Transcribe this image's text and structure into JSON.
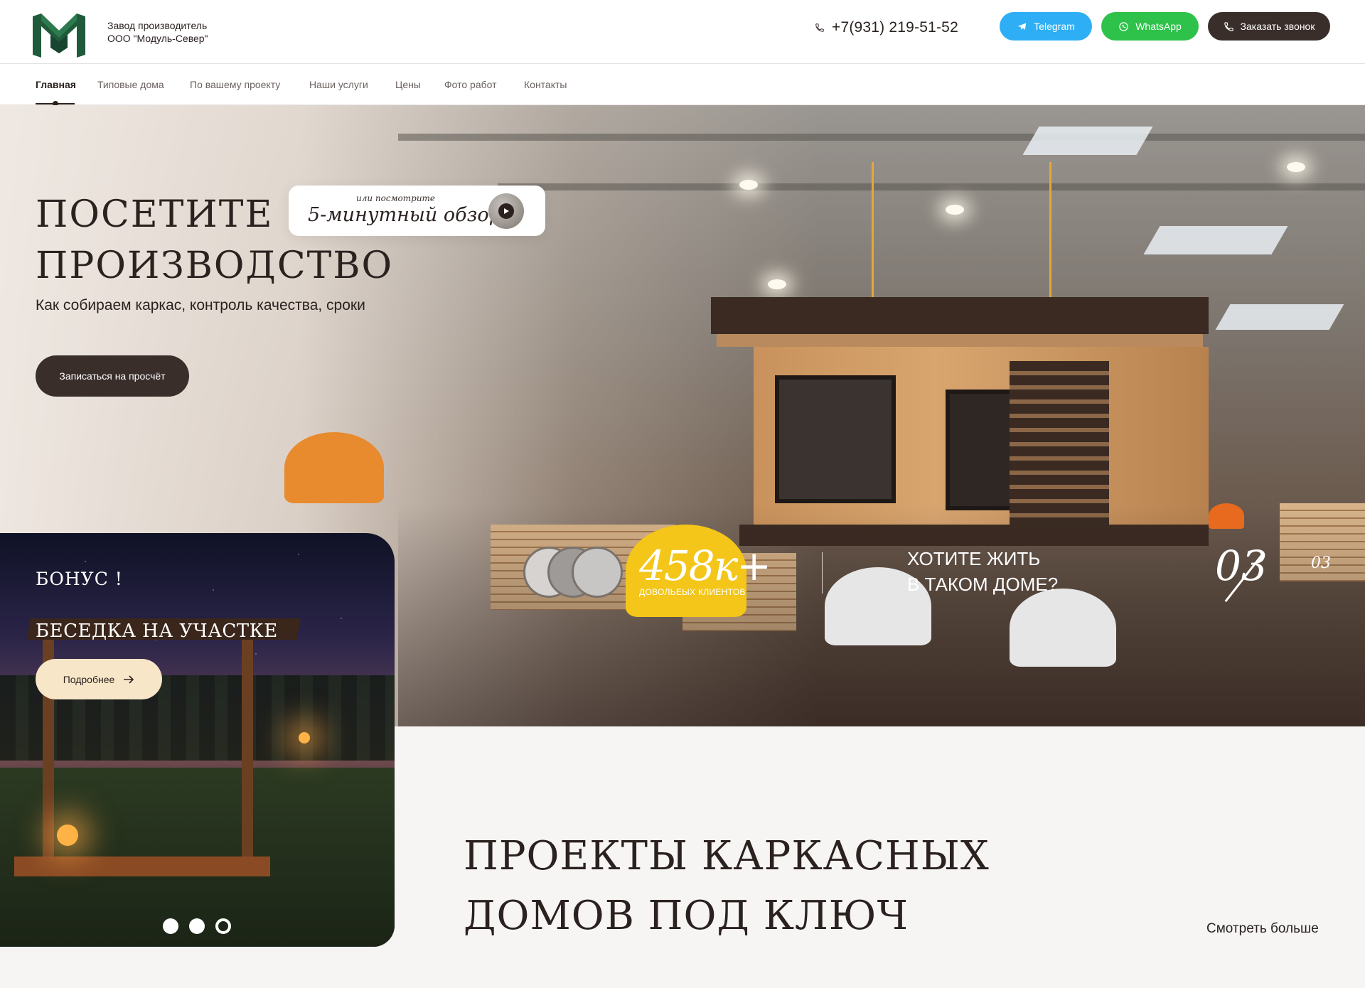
{
  "header": {
    "company_line1": "Завод производитель",
    "company_line2": "ООО \"Модуль-Север\"",
    "phone": "+7(931) 219-51-52",
    "telegram_label": "Telegram",
    "whatsapp_label": "WhatsApp",
    "callback_label": "Заказать звонок",
    "colors": {
      "telegram": "#2eaff5",
      "whatsapp": "#2ec24a",
      "dark": "#3a2e2b",
      "logo_green": "#1f5a3a"
    }
  },
  "nav": {
    "items": [
      {
        "label": "Главная",
        "active": true
      },
      {
        "label": "Типовые дома"
      },
      {
        "label": "По вашему проекту"
      },
      {
        "label": "Наши услуги"
      },
      {
        "label": "Цены"
      },
      {
        "label": "Фото работ"
      },
      {
        "label": "Контакты"
      }
    ]
  },
  "hero": {
    "title_line1": "ПОСЕТИТЕ",
    "title_line2": "ПРОИЗВОДСТВО",
    "subtitle": "Как собираем каркас, контроль качества, сроки",
    "cta_label": "Записаться на просчёт",
    "video_small": "или посмотрите",
    "video_big": "5-минутный обзор"
  },
  "bonus": {
    "title": "БОНУС !",
    "subtitle": "БЕСЕДКА НА УЧАСТКЕ",
    "button_label": "Подробнее",
    "slides_total": 3,
    "active_slide": 3
  },
  "stats": {
    "clients_number": "458к+",
    "clients_label": "ДОВОЛЬЕЫХ КЛИЕНТОВ",
    "question_line1": "ХОТИТЕ ЖИТЬ",
    "question_line2": "В ТАКОМ ДОМЕ?",
    "counter_current": "03",
    "counter_total": "03"
  },
  "projects": {
    "title_line1": "ПРОЕКТЫ КАРКАСНЫХ",
    "title_line2": "ДОМОВ ПОД КЛЮЧ",
    "more_label": "Смотреть больше"
  }
}
